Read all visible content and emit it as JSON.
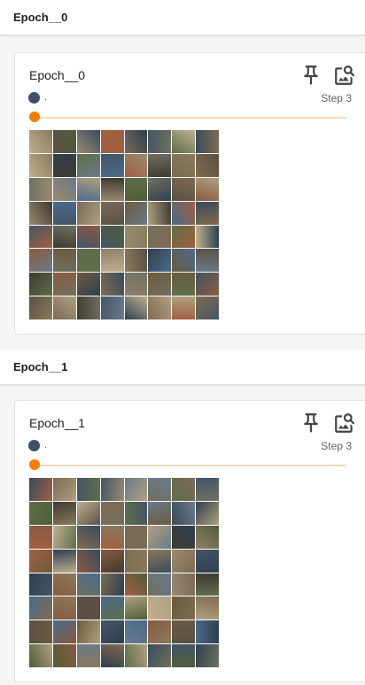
{
  "groups": [
    {
      "header": "Epoch__0",
      "card": {
        "title": "Epoch__0",
        "run_name": ".",
        "step_label": "Step 3",
        "step_fraction": 0,
        "pin_icon": "pin-icon",
        "image_icon": "image-search-icon"
      }
    },
    {
      "header": "Epoch__1",
      "card": {
        "title": "Epoch__1",
        "run_name": ".",
        "step_label": "Step 3",
        "step_fraction": 0,
        "pin_icon": "pin-icon",
        "image_icon": "image-search-icon"
      }
    }
  ],
  "colors": {
    "accent": "#f57c00",
    "accent_track": "#fbd8b4",
    "run_dot": "#3f4f66"
  }
}
